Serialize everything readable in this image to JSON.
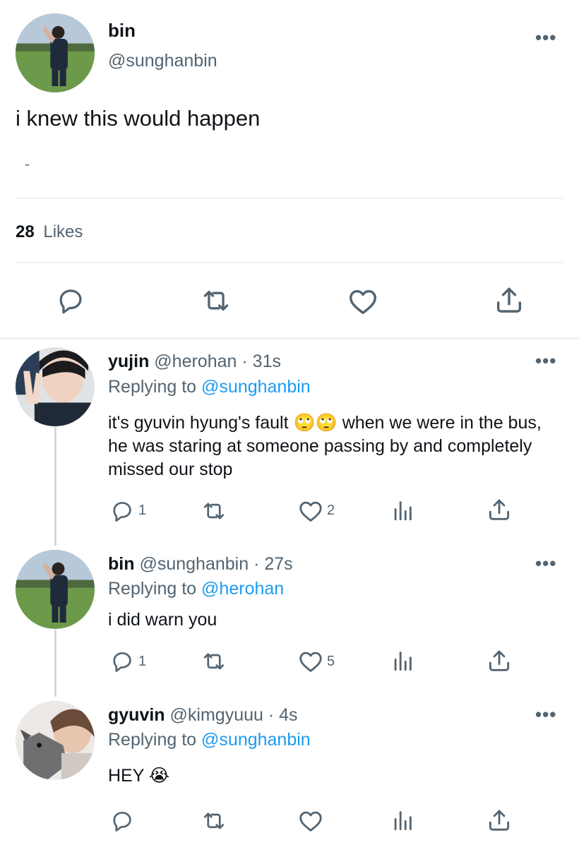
{
  "main_tweet": {
    "author_name": "bin",
    "author_handle": "@sunghanbin",
    "text": "i knew this would happen",
    "small_mark": "˘",
    "likes_count": "28",
    "likes_label": "Likes"
  },
  "replies": [
    {
      "name": "yujin",
      "handle": "@herohan",
      "sep": "·",
      "time": "31s",
      "replying_label": "Replying to",
      "replying_to": "@sunghanbin",
      "text_before": "it's gyuvin hyung's fault",
      "emoji": "🙄🙄",
      "text_after": " when we were in the bus, he was staring at someone passing by and completely missed our stop",
      "reply_count": "1",
      "like_count": "2"
    },
    {
      "name": "bin",
      "handle": "@sunghanbin",
      "sep": "·",
      "time": "27s",
      "replying_label": "Replying to",
      "replying_to": "@herohan",
      "text": "i did warn you",
      "reply_count": "1",
      "like_count": "5"
    },
    {
      "name": "gyuvin",
      "handle": "@kimgyuuu",
      "sep": "·",
      "time": "4s",
      "replying_label": "Replying to",
      "replying_to": "@sunghanbin",
      "text": "HEY",
      "emoji": "😭"
    }
  ],
  "icons": [
    "reply-icon",
    "retweet-icon",
    "like-icon",
    "share-icon",
    "analytics-icon",
    "more-icon"
  ],
  "colors": {
    "link": "#1d9bf0",
    "muted": "#536471",
    "divider": "#eff3f4"
  }
}
